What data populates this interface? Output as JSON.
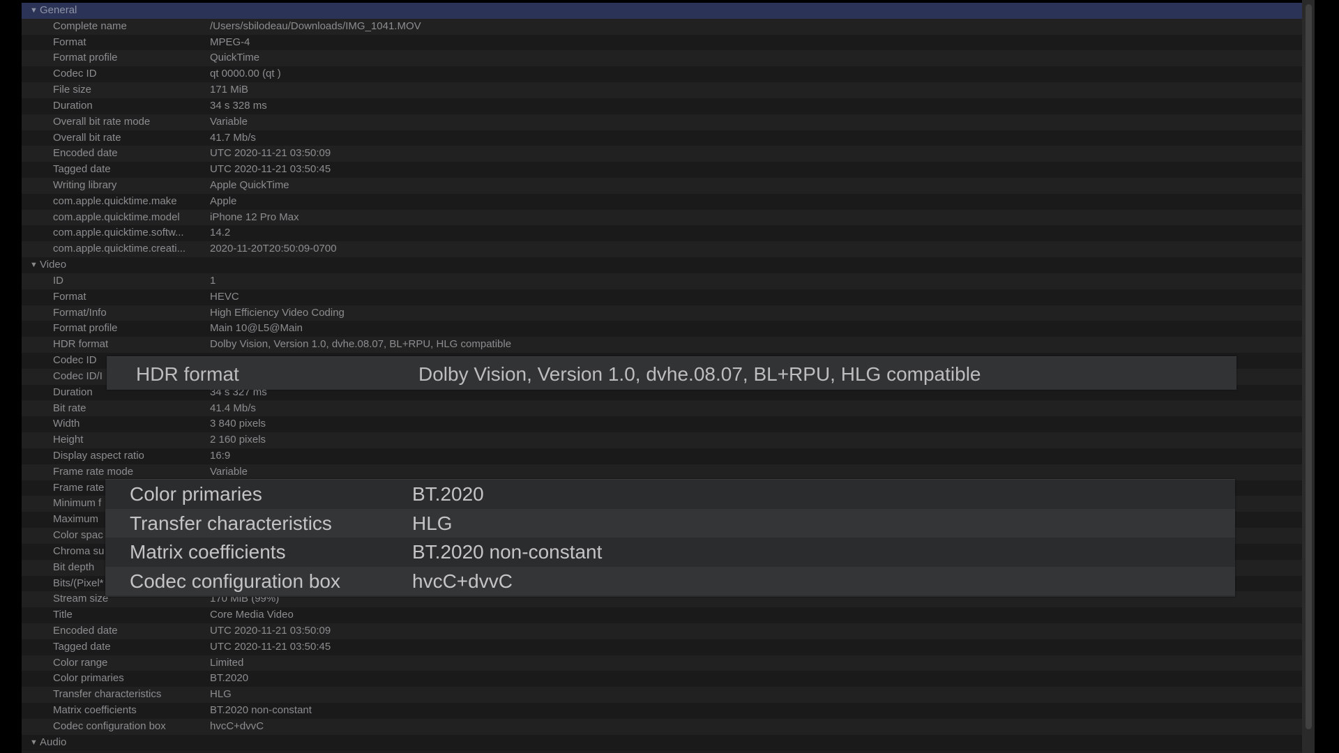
{
  "sections": [
    {
      "title": "General",
      "selected": true,
      "items": [
        {
          "label": "Complete name",
          "value": "/Users/sbilodeau/Downloads/IMG_1041.MOV"
        },
        {
          "label": "Format",
          "value": "MPEG-4"
        },
        {
          "label": "Format profile",
          "value": "QuickTime"
        },
        {
          "label": "Codec ID",
          "value": "qt   0000.00 (qt  )"
        },
        {
          "label": "File size",
          "value": "171 MiB"
        },
        {
          "label": "Duration",
          "value": "34 s 328 ms"
        },
        {
          "label": "Overall bit rate mode",
          "value": "Variable"
        },
        {
          "label": "Overall bit rate",
          "value": "41.7 Mb/s"
        },
        {
          "label": "Encoded date",
          "value": "UTC 2020-11-21 03:50:09"
        },
        {
          "label": "Tagged date",
          "value": "UTC 2020-11-21 03:50:45"
        },
        {
          "label": "Writing library",
          "value": "Apple QuickTime"
        },
        {
          "label": "com.apple.quicktime.make",
          "value": "Apple"
        },
        {
          "label": "com.apple.quicktime.model",
          "value": "iPhone 12 Pro Max"
        },
        {
          "label": "com.apple.quicktime.softw...",
          "value": "14.2"
        },
        {
          "label": "com.apple.quicktime.creati...",
          "value": "2020-11-20T20:50:09-0700"
        }
      ]
    },
    {
      "title": "Video",
      "selected": false,
      "items": [
        {
          "label": "ID",
          "value": "1"
        },
        {
          "label": "Format",
          "value": "HEVC"
        },
        {
          "label": "Format/Info",
          "value": "High Efficiency Video Coding"
        },
        {
          "label": "Format profile",
          "value": "Main 10@L5@Main"
        },
        {
          "label": "HDR format",
          "value": "Dolby Vision, Version 1.0, dvhe.08.07, BL+RPU, HLG compatible"
        },
        {
          "label": "Codec ID",
          "value": ""
        },
        {
          "label": "Codec ID/I",
          "value": ""
        },
        {
          "label": "Duration",
          "value": "34 s 327 ms"
        },
        {
          "label": "Bit rate",
          "value": "41.4 Mb/s"
        },
        {
          "label": "Width",
          "value": "3 840 pixels"
        },
        {
          "label": "Height",
          "value": "2 160 pixels"
        },
        {
          "label": "Display aspect ratio",
          "value": "16:9"
        },
        {
          "label": "Frame rate mode",
          "value": "Variable"
        },
        {
          "label": "Frame rate",
          "value": ""
        },
        {
          "label": "Minimum f",
          "value": ""
        },
        {
          "label": "Maximum",
          "value": ""
        },
        {
          "label": "Color spac",
          "value": ""
        },
        {
          "label": "Chroma su",
          "value": ""
        },
        {
          "label": "Bit depth",
          "value": ""
        },
        {
          "label": "Bits/(Pixel*",
          "value": ""
        },
        {
          "label": "Stream size",
          "value": "170 MiB (99%)"
        },
        {
          "label": "Title",
          "value": "Core Media Video"
        },
        {
          "label": "Encoded date",
          "value": "UTC 2020-11-21 03:50:09"
        },
        {
          "label": "Tagged date",
          "value": "UTC 2020-11-21 03:50:45"
        },
        {
          "label": "Color range",
          "value": "Limited"
        },
        {
          "label": "Color primaries",
          "value": "BT.2020"
        },
        {
          "label": "Transfer characteristics",
          "value": "HLG"
        },
        {
          "label": "Matrix coefficients",
          "value": "BT.2020 non-constant"
        },
        {
          "label": "Codec configuration box",
          "value": "hvcC+dvvC"
        }
      ]
    },
    {
      "title": "Audio",
      "selected": false,
      "items": []
    }
  ],
  "zoom_overlay_hdr": {
    "label": "HDR format",
    "value": "Dolby Vision, Version 1.0, dvhe.08.07, BL+RPU, HLG compatible"
  },
  "zoom_overlay_color": [
    {
      "label": "Color primaries",
      "value": "BT.2020"
    },
    {
      "label": "Transfer characteristics",
      "value": "HLG"
    },
    {
      "label": "Matrix coefficients",
      "value": "BT.2020 non-constant"
    },
    {
      "label": "Codec configuration box",
      "value": "hvcC+dvvC"
    }
  ],
  "icons": {
    "section_toggle": "disclosure-triangle-down"
  },
  "colors": {
    "selected_row": "#2b3456",
    "background": "#1e1e1f"
  }
}
